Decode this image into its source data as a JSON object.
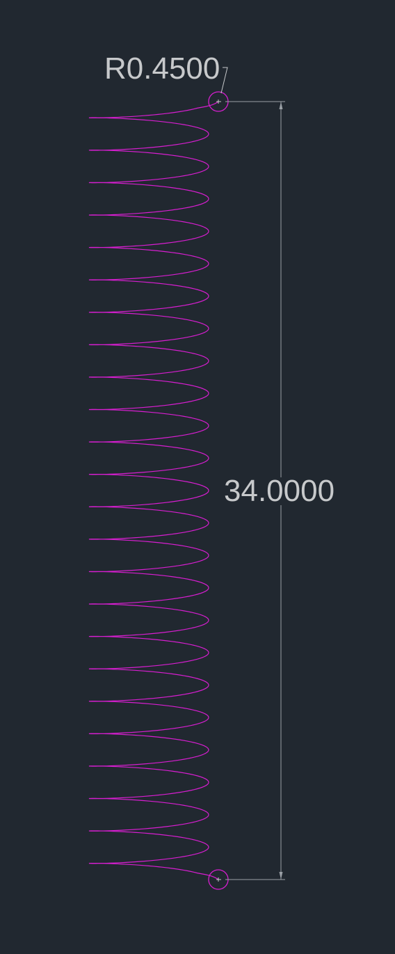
{
  "drawing": {
    "radius_label": "R0.4500",
    "length_label": "34.0000",
    "spring_turns": 24,
    "colors": {
      "background": "#212830",
      "spring": "#d81ed1",
      "dimension": "#c7c9cb",
      "dimension_line": "#9aa0a6"
    }
  }
}
